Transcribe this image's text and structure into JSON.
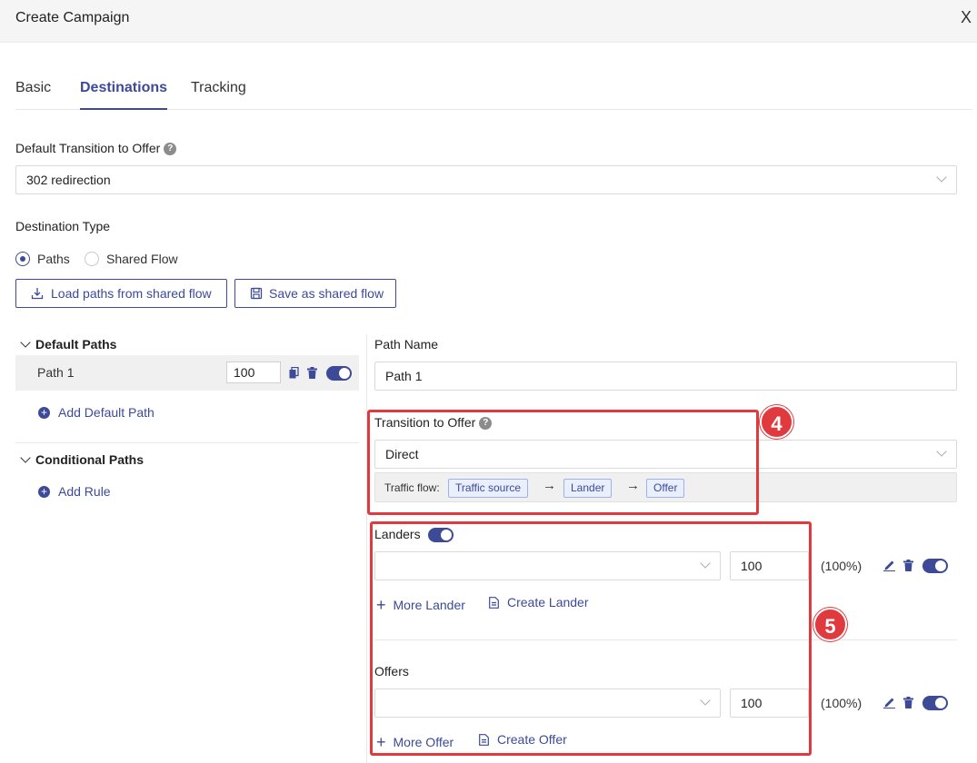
{
  "dialog": {
    "title": "Create Campaign",
    "close_label": "X"
  },
  "tabs": [
    {
      "label": "Basic",
      "active": false
    },
    {
      "label": "Destinations",
      "active": true
    },
    {
      "label": "Tracking",
      "active": false
    }
  ],
  "default_transition": {
    "label": "Default Transition to Offer",
    "help": "?",
    "value": "302 redirection"
  },
  "destination_type": {
    "label": "Destination Type",
    "options": [
      {
        "label": "Paths",
        "selected": true
      },
      {
        "label": "Shared Flow",
        "selected": false
      }
    ]
  },
  "buttons": {
    "load": "Load paths from shared flow",
    "save": "Save as shared flow"
  },
  "tree": {
    "default_paths_label": "Default Paths",
    "paths": [
      {
        "name": "Path 1",
        "weight": "100",
        "enabled": true
      }
    ],
    "add_default_path": "Add Default Path",
    "conditional_paths_label": "Conditional Paths",
    "add_rule": "Add Rule"
  },
  "path_editor": {
    "name_label": "Path Name",
    "name_value": "Path 1",
    "transition_label": "Transition to Offer",
    "transition_help": "?",
    "transition_value": "Direct",
    "flow_label": "Traffic flow:",
    "flow_steps": [
      "Traffic source",
      "Lander",
      "Offer"
    ],
    "landers": {
      "label": "Landers",
      "enabled": true,
      "select_value": "",
      "weight": "100",
      "percent": "(100%)",
      "more": "More Lander",
      "create": "Create Lander"
    },
    "offers": {
      "label": "Offers",
      "select_value": "",
      "weight": "100",
      "percent": "(100%)",
      "more": "More Offer",
      "create": "Create Offer"
    }
  },
  "annotations": {
    "badge_4": "4",
    "badge_5": "5"
  },
  "colors": {
    "accent": "#3c4a98",
    "highlight": "#e0393e",
    "chip_bg": "#e9effd"
  }
}
